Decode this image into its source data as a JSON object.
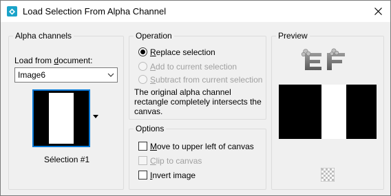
{
  "window": {
    "title": "Load Selection From Alpha Channel"
  },
  "alpha_channels": {
    "group_label": "Alpha channels",
    "load_from_label": "Load from ",
    "load_from_underlined": "d",
    "load_from_rest": "ocument:",
    "document_value": "Image6",
    "selection_caption": "Sélection #1"
  },
  "operation": {
    "group_label": "Operation",
    "options": [
      {
        "underlined": "R",
        "rest": "eplace selection",
        "selected": true,
        "enabled": true
      },
      {
        "underlined": "A",
        "rest": "dd to current selection",
        "selected": false,
        "enabled": false
      },
      {
        "underlined": "S",
        "rest": "ubtract from current selection",
        "selected": false,
        "enabled": false
      }
    ],
    "description": "The original alpha channel rectangle completely intersects the canvas."
  },
  "options": {
    "group_label": "Options",
    "items": [
      {
        "underlined": "M",
        "rest": "ove to upper left of canvas",
        "checked": false,
        "enabled": true
      },
      {
        "underlined": "C",
        "rest": "lip to canvas",
        "checked": false,
        "enabled": false
      },
      {
        "underlined": "I",
        "rest": "nvert image",
        "checked": false,
        "enabled": true
      }
    ]
  },
  "preview": {
    "group_label": "Preview",
    "logo_text": "EF"
  },
  "colors": {
    "accent": "#0078d7",
    "disabled_text": "#a0a0a0",
    "panel": "#f0f0f0"
  }
}
